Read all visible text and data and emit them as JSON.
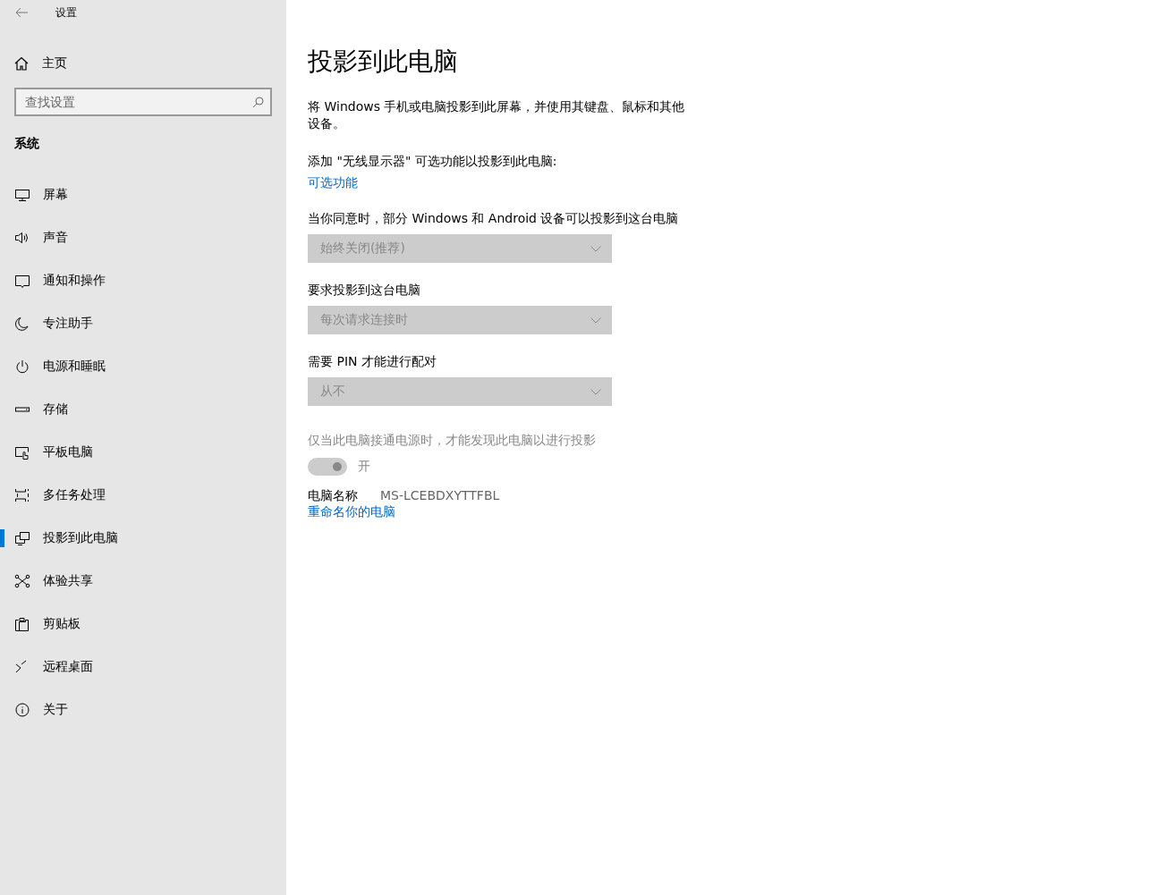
{
  "window": {
    "title": "设置"
  },
  "sidebar": {
    "home": "主页",
    "search": {
      "placeholder": "查找设置"
    },
    "section": "系统",
    "items": [
      {
        "label": "屏幕",
        "kind": "display",
        "selected": false
      },
      {
        "label": "声音",
        "kind": "sound",
        "selected": false
      },
      {
        "label": "通知和操作",
        "kind": "notify",
        "selected": false
      },
      {
        "label": "专注助手",
        "kind": "moon",
        "selected": false
      },
      {
        "label": "电源和睡眠",
        "kind": "power",
        "selected": false
      },
      {
        "label": "存储",
        "kind": "storage",
        "selected": false
      },
      {
        "label": "平板电脑",
        "kind": "tablet",
        "selected": false
      },
      {
        "label": "多任务处理",
        "kind": "multitask",
        "selected": false
      },
      {
        "label": "投影到此电脑",
        "kind": "project",
        "selected": true
      },
      {
        "label": "体验共享",
        "kind": "share",
        "selected": false
      },
      {
        "label": "剪贴板",
        "kind": "clipboard",
        "selected": false
      },
      {
        "label": "远程桌面",
        "kind": "remote",
        "selected": false
      },
      {
        "label": "关于",
        "kind": "info",
        "selected": false
      }
    ]
  },
  "main": {
    "title": "投影到此电脑",
    "description": "将 Windows 手机或电脑投影到此屏幕，并使用其键盘、鼠标和其他设备。",
    "add_feature_text": "添加 \"无线显示器\" 可选功能以投影到此电脑:",
    "add_feature_link": "可选功能",
    "dropdowns": [
      {
        "label": "当你同意时，部分 Windows 和 Android 设备可以投影到这台电脑",
        "value": "始终关闭(推荐)",
        "disabled": true
      },
      {
        "label": "要求投影到这台电脑",
        "value": "每次请求连接时",
        "disabled": true
      },
      {
        "label": "需要 PIN 才能进行配对",
        "value": "从不",
        "disabled": true
      }
    ],
    "power_toggle": {
      "label": "仅当此电脑接通电源时，才能发现此电脑以进行投影",
      "state_text": "开",
      "on": true,
      "disabled": true
    },
    "pc_name_label": "电脑名称",
    "pc_name": "MS-LCEBDXYTTFBL",
    "rename_link": "重命名你的电脑"
  }
}
